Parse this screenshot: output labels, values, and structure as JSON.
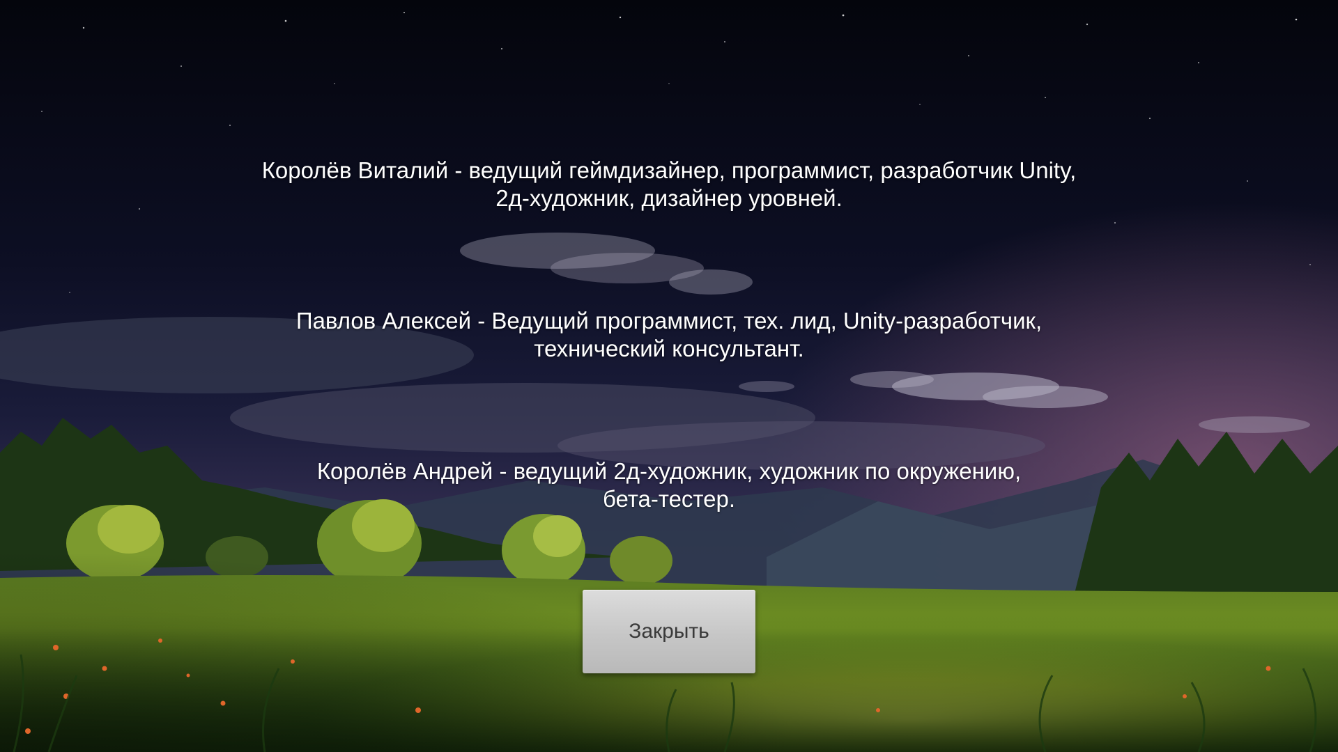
{
  "credits": [
    {
      "line1": "Королёв Виталий - ведущий геймдизайнер, программист, разработчик Unity,",
      "line2": "2д-художник, дизайнер уровней."
    },
    {
      "line1": "Павлов Алексей - Ведущий программист, тех. лид, Unity-разработчик,",
      "line2": "технический консультант."
    },
    {
      "line1": "Королёв Андрей - ведущий 2д-художник, художник по окружению,",
      "line2": "бета-тестер."
    }
  ],
  "close_button": {
    "label": "Закрыть"
  },
  "colors": {
    "sky_top": "#05060f",
    "sky_mid": "#121530",
    "horizon_glow": "#5a3f63",
    "meadow_light": "#d9d640",
    "meadow_dark": "#1d3a12",
    "text": "#ffffff",
    "button_bg": "#c8c8c8",
    "button_text": "#3a3a3a"
  }
}
